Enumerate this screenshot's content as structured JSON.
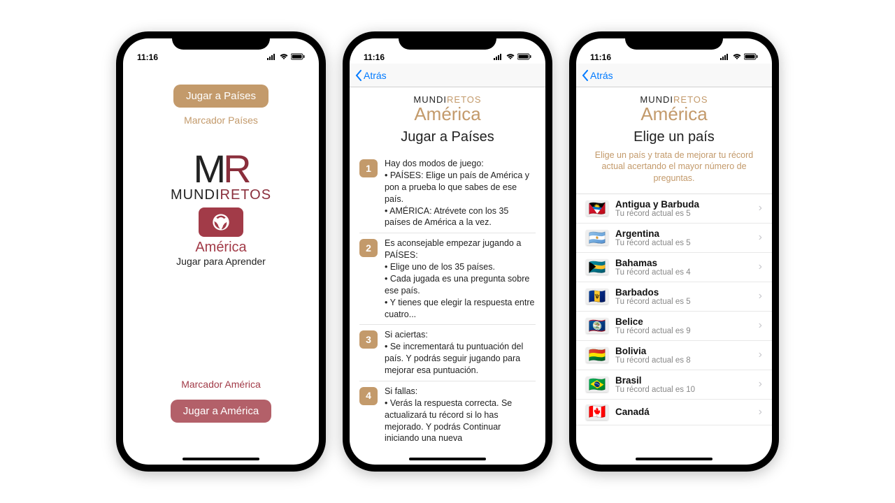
{
  "status": {
    "time": "11:16"
  },
  "nav": {
    "back": "Atrás"
  },
  "brand": {
    "mundi": "MUNDI",
    "retos": "RETOS",
    "m": "M",
    "r": "R",
    "america": "América",
    "tagline": "Jugar para Aprender"
  },
  "screen1": {
    "play_countries": "Jugar a Países",
    "score_countries": "Marcador Países",
    "score_america": "Marcador América",
    "play_america": "Jugar a América"
  },
  "screen2": {
    "title": "Jugar a Países",
    "rules": [
      {
        "n": "1",
        "text": "Hay dos modos de juego:\n• PAÍSES: Elige un país de América y pon a prueba lo que sabes de ese país.\n• AMÉRICA: Atrévete con los 35 países de América a la vez."
      },
      {
        "n": "2",
        "text": "Es aconsejable empezar jugando a PAÍSES:\n• Elige uno de los 35 países.\n• Cada jugada es una pregunta sobre ese país.\n• Y tienes que elegir la respuesta entre cuatro..."
      },
      {
        "n": "3",
        "text": "Si aciertas:\n• Se incrementará tu puntuación del país. Y podrás seguir jugando para mejorar esa puntuación."
      },
      {
        "n": "4",
        "text": "Si fallas:\n• Verás la respuesta correcta. Se actualizará tu récord si lo has mejorado. Y podrás Continuar iniciando una nueva"
      }
    ]
  },
  "screen3": {
    "title": "Elige un país",
    "hint": "Elige un país y trata de mejorar tu récord actual acertando el mayor número de preguntas.",
    "record_prefix": "Tu récord actual es ",
    "countries": [
      {
        "name": "Antigua y Barbuda",
        "record": 5,
        "flag": "🇦🇬"
      },
      {
        "name": "Argentina",
        "record": 5,
        "flag": "🇦🇷"
      },
      {
        "name": "Bahamas",
        "record": 4,
        "flag": "🇧🇸"
      },
      {
        "name": "Barbados",
        "record": 5,
        "flag": "🇧🇧"
      },
      {
        "name": "Belice",
        "record": 9,
        "flag": "🇧🇿"
      },
      {
        "name": "Bolivia",
        "record": 8,
        "flag": "🇧🇴"
      },
      {
        "name": "Brasil",
        "record": 10,
        "flag": "🇧🇷"
      },
      {
        "name": "Canadá",
        "record": null,
        "flag": "🇨🇦"
      }
    ]
  }
}
